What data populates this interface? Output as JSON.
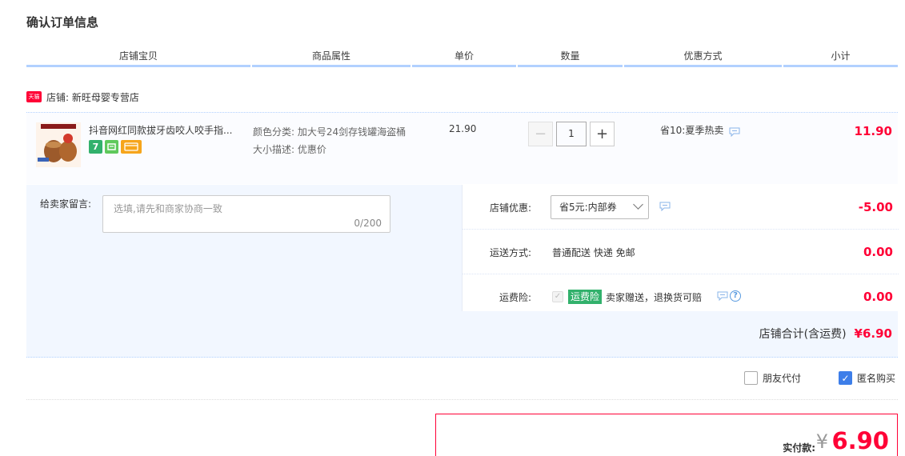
{
  "page": {
    "title": "确认订单信息"
  },
  "table_header": {
    "columns": [
      "店铺宝贝",
      "商品属性",
      "单价",
      "数量",
      "优惠方式",
      "小计"
    ]
  },
  "shop": {
    "badge": "天猫",
    "label": "店铺: 新旺母婴专营店"
  },
  "item": {
    "title": "抖音网红同款拔牙齿咬人咬手指...",
    "service_icons": [
      "seven-day-return-icon",
      "guarantee-icon",
      "card-icon"
    ],
    "props": [
      "颜色分类: 加大号24剑存钱罐海盗桶",
      "大小描述: 优惠价"
    ],
    "unit_price": "21.90",
    "quantity": "1",
    "promotion": "省10:夏季热卖",
    "subtotal": "11.90"
  },
  "memo": {
    "label": "给卖家留言:",
    "placeholder": "选填,请先和商家协商一致",
    "count": "0/200"
  },
  "shop_coupon": {
    "label": "店铺优惠:",
    "selected": "省5元:内部券",
    "value": "-5.00"
  },
  "shipping": {
    "label": "运送方式:",
    "text": "普通配送 快递 免邮",
    "value": "0.00"
  },
  "insurance": {
    "label": "运费险:",
    "tag": "运费险",
    "text": "卖家赠送，退换货可赔",
    "value": "0.00"
  },
  "shop_total": {
    "label": "店铺合计(含运费)",
    "value": "¥6.90"
  },
  "options": {
    "friend_pay": {
      "label": "朋友代付",
      "checked": false
    },
    "anonymous": {
      "label": "匿名购买",
      "checked": true
    }
  },
  "payment": {
    "label": "实付款:",
    "currency": "¥",
    "amount": "6.90"
  },
  "colors": {
    "price_red": "#ff0036",
    "header_blue": "#b2d1ff",
    "panel_bg": "#f2f7ff",
    "check_blue": "#3d7ee9"
  }
}
